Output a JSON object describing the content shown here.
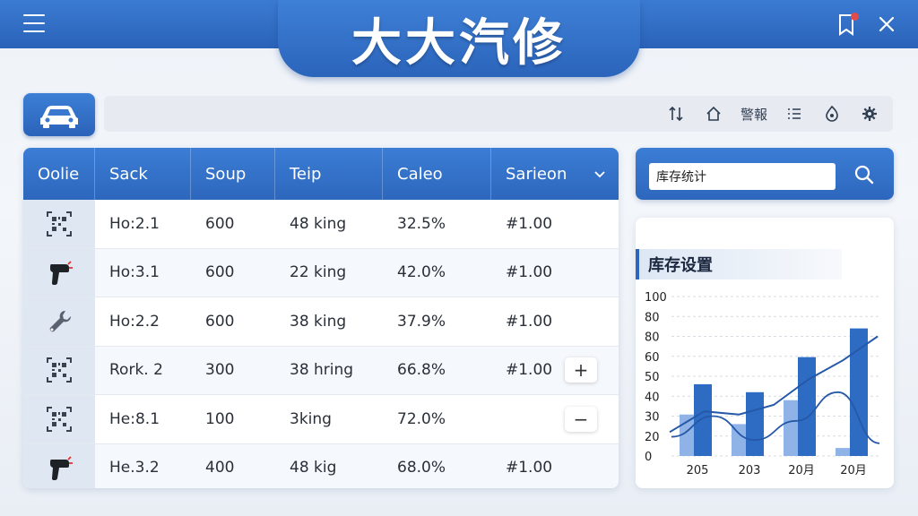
{
  "app": {
    "title": "大大汽修"
  },
  "toolbar": {
    "icons": [
      "sort-icon",
      "home-icon",
      "alert-label",
      "list-icon",
      "tag-icon",
      "gear-icon"
    ],
    "alert_text": "警報"
  },
  "table": {
    "headers": [
      "Oolie",
      "Sack",
      "Soup",
      "Teip",
      "Caleo",
      "Sarieon"
    ],
    "rows": [
      {
        "icon": "qr-code-icon",
        "c1": "Ho:2.1",
        "c2": "600",
        "c3": "48 king",
        "c4": "32.5%",
        "c5": "#1.00",
        "action": ""
      },
      {
        "icon": "scanner-gun-icon",
        "c1": "Ho:3.1",
        "c2": "600",
        "c3": "22 king",
        "c4": "42.0%",
        "c5": "#1.00",
        "action": ""
      },
      {
        "icon": "wrench-icon",
        "c1": "Ho:2.2",
        "c2": "600",
        "c3": "38 king",
        "c4": "37.9%",
        "c5": "#1.00",
        "action": ""
      },
      {
        "icon": "qr-code-icon",
        "c1": "Rork. 2",
        "c2": "300",
        "c3": "38 hring",
        "c4": "66.8%",
        "c5": "#1.00",
        "action": "+"
      },
      {
        "icon": "qr-code-icon",
        "c1": "He:8.1",
        "c2": "100",
        "c3": "3king",
        "c4": "72.0%",
        "c5": "",
        "action": "−"
      },
      {
        "icon": "scanner-gun-icon",
        "c1": "He.3.2",
        "c2": "400",
        "c3": "48 kig",
        "c4": "68.0%",
        "c5": "#1.00",
        "action": ""
      }
    ]
  },
  "search": {
    "value": "库存统计"
  },
  "chart_data": {
    "type": "bar",
    "title": "库存设置",
    "categories": [
      "205",
      "203",
      "20月",
      "20月"
    ],
    "series": [
      {
        "values": [
          45,
          40,
          62,
          80
        ]
      },
      {
        "values": [
          26,
          20,
          35,
          5
        ]
      }
    ],
    "line": [
      15,
      28,
      26,
      32,
      48,
      60,
      75
    ],
    "curve": [
      12,
      25,
      10,
      22,
      40,
      8
    ],
    "yticks": [
      "0",
      "20",
      "30",
      "40",
      "50",
      "60",
      "80",
      "80",
      "100"
    ],
    "ylim": [
      0,
      100
    ],
    "colors": {
      "bar": "#2e6cc4",
      "bar_light": "#8fb3e6",
      "line": "#2558a8"
    }
  }
}
